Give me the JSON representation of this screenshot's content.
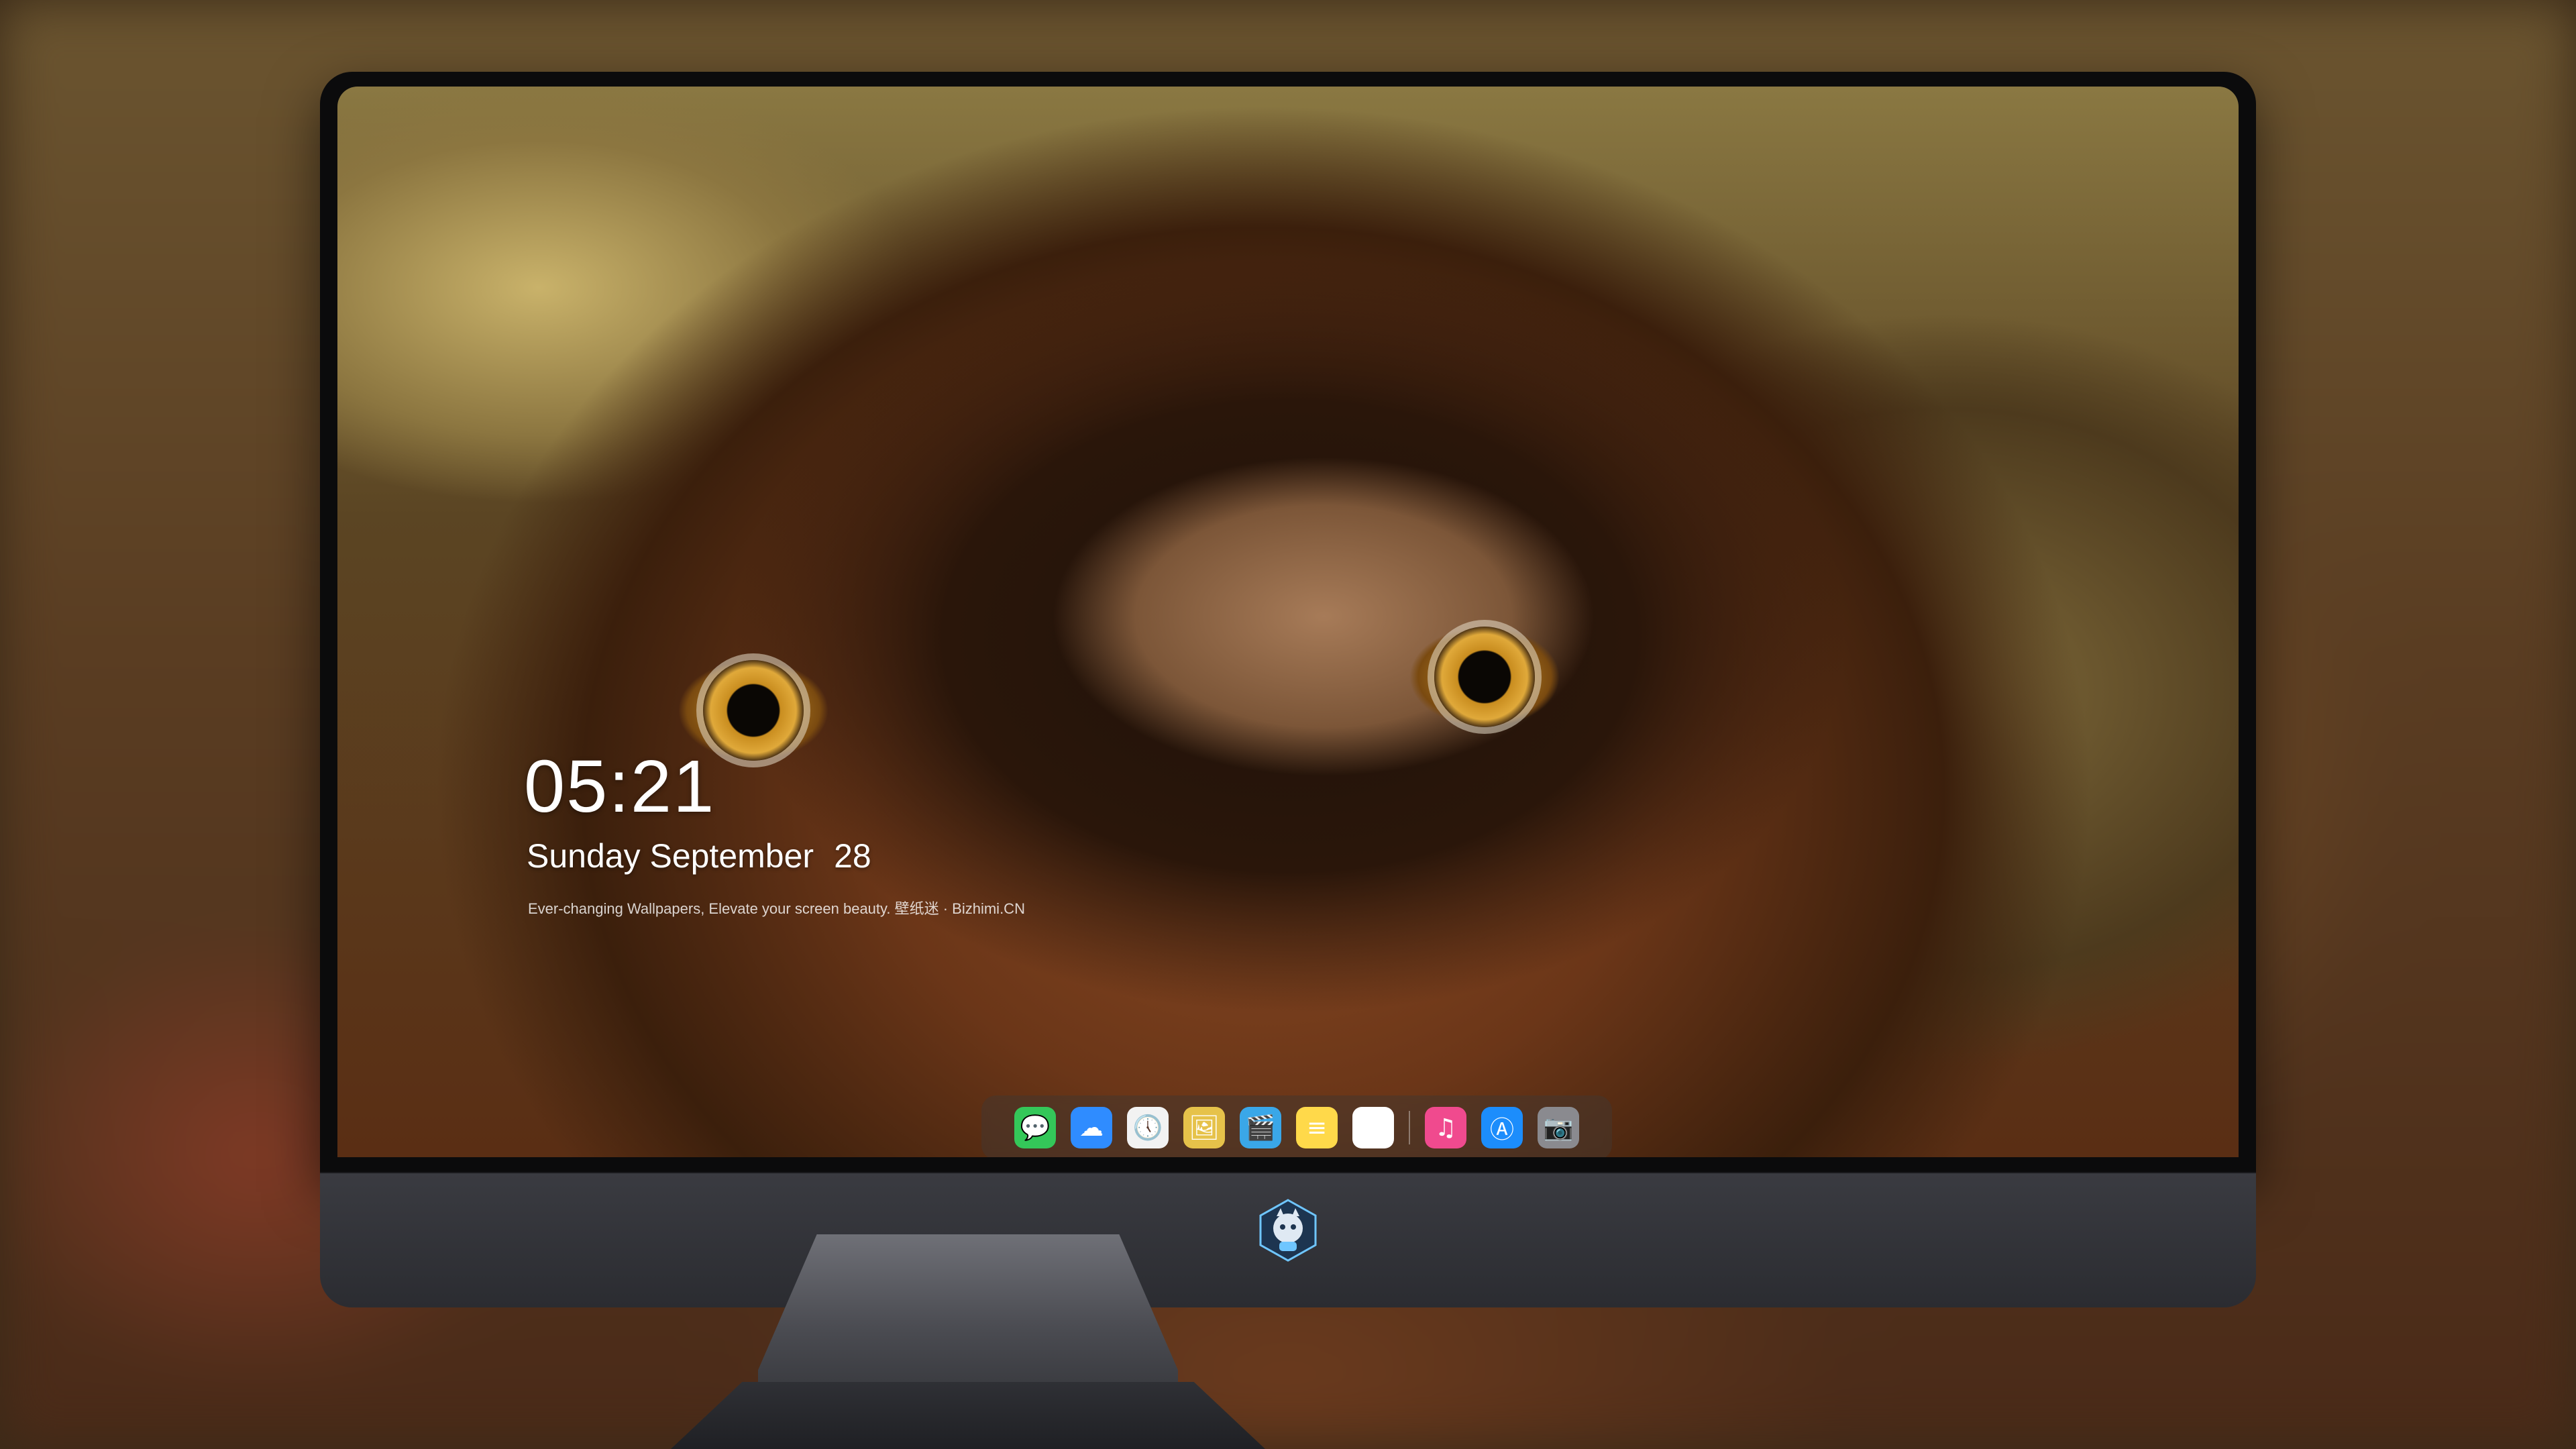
{
  "lockscreen": {
    "time": "05:21",
    "weekday_month": "Sunday September",
    "day": "28",
    "tagline": "Ever-changing Wallpapers, Elevate your screen beauty. 壁纸迷 · Bizhimi.CN"
  },
  "dock": {
    "icons": [
      {
        "name": "messages-icon",
        "glyph": "💬",
        "color": "#34c759"
      },
      {
        "name": "weather-icon",
        "glyph": "☁",
        "color": "#2f8cff"
      },
      {
        "name": "clock-icon",
        "glyph": "🕔",
        "color": "#f2f2f2"
      },
      {
        "name": "preview-icon",
        "glyph": "🖼",
        "color": "#e6c24a"
      },
      {
        "name": "clips-icon",
        "glyph": "🎬",
        "color": "#3aa7e8"
      },
      {
        "name": "notes-icon",
        "glyph": "≡",
        "color": "#ffd94a"
      },
      {
        "name": "photos-icon",
        "glyph": "▦",
        "color": "#ffffff"
      },
      {
        "name": "music-icon",
        "glyph": "♫",
        "color": "#f04a8e"
      },
      {
        "name": "app-store-icon",
        "glyph": "Ⓐ",
        "color": "#1c8dfc"
      },
      {
        "name": "camera-icon",
        "glyph": "📷",
        "color": "#8a8a8f"
      }
    ]
  }
}
